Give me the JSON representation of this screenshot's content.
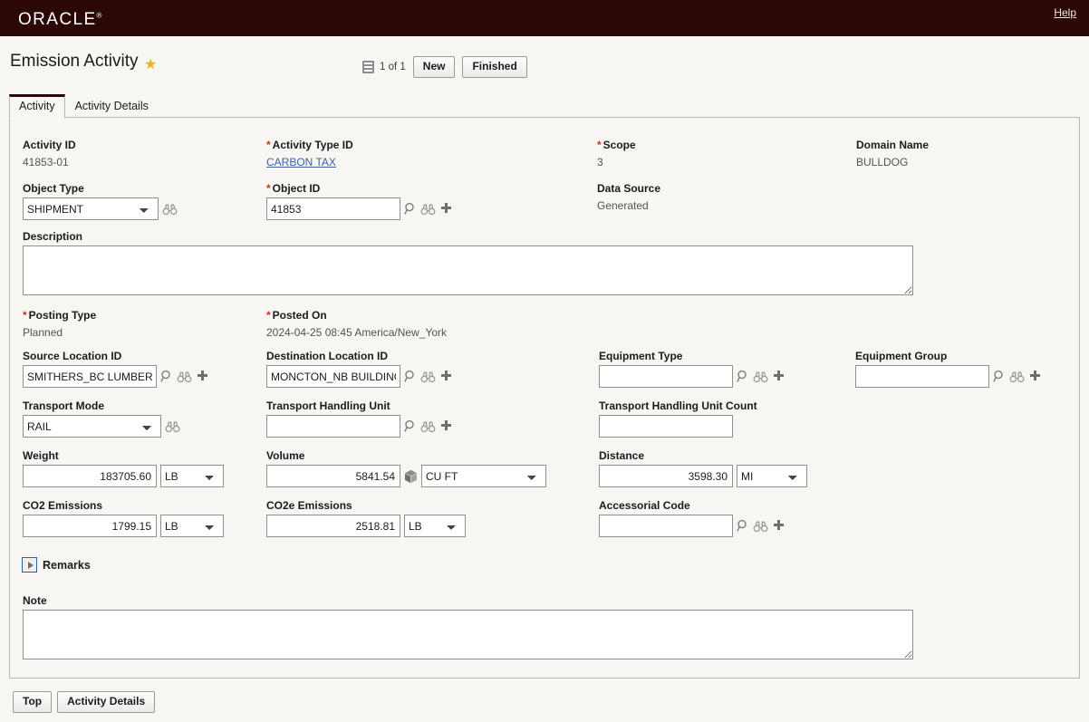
{
  "brand": {
    "name": "ORACLE",
    "trademark": "®",
    "help_label": "Help",
    "bar_color": "#2b0706"
  },
  "header": {
    "title": "Emission Activity",
    "favorite_icon": "star-icon",
    "record_count": "1 of 1",
    "list_icon": "list-view-icon",
    "new_label": "New",
    "finished_label": "Finished"
  },
  "tabs": [
    {
      "label": "Activity",
      "active": true
    },
    {
      "label": "Activity Details",
      "active": false
    }
  ],
  "form": {
    "activity_id": {
      "label": "Activity ID",
      "value": "41853-01"
    },
    "activity_type_id": {
      "label": "Activity Type ID",
      "required": "*",
      "value": "CARBON TAX"
    },
    "scope": {
      "label": "Scope",
      "required": "*",
      "value": "3"
    },
    "domain_name": {
      "label": "Domain Name",
      "value": "BULLDOG"
    },
    "object_type": {
      "label": "Object Type",
      "value": "SHIPMENT",
      "options": [
        "SHIPMENT"
      ]
    },
    "object_id": {
      "label": "Object ID",
      "required": "*",
      "value": "41853"
    },
    "data_source": {
      "label": "Data Source",
      "value": "Generated"
    },
    "description": {
      "label": "Description",
      "value": ""
    },
    "posting_type": {
      "label": "Posting Type",
      "required": "*",
      "value": "Planned"
    },
    "posted_on": {
      "label": "Posted On",
      "required": "*",
      "value": "2024-04-25 08:45 America/New_York"
    },
    "source_location_id": {
      "label": "Source Location ID",
      "value": "SMITHERS_BC LUMBER MILL"
    },
    "destination_location_id": {
      "label": "Destination Location ID",
      "value": "MONCTON_NB BUILDING"
    },
    "equipment_type": {
      "label": "Equipment Type",
      "value": ""
    },
    "equipment_group": {
      "label": "Equipment Group",
      "value": ""
    },
    "transport_mode": {
      "label": "Transport Mode",
      "value": "RAIL",
      "options": [
        "RAIL"
      ]
    },
    "transport_handling_unit": {
      "label": "Transport Handling Unit",
      "value": ""
    },
    "transport_handling_unit_count": {
      "label": "Transport Handling Unit Count",
      "value": ""
    },
    "weight": {
      "label": "Weight",
      "value": "183705.60",
      "uom": "LB",
      "uom_options": [
        "LB"
      ]
    },
    "volume": {
      "label": "Volume",
      "value": "5841.54",
      "uom": "CU FT",
      "uom_options": [
        "CU FT"
      ]
    },
    "distance": {
      "label": "Distance",
      "value": "3598.30",
      "uom": "MI",
      "uom_options": [
        "MI"
      ]
    },
    "co2_emissions": {
      "label": "CO2 Emissions",
      "value": "1799.15",
      "uom": "LB",
      "uom_options": [
        "LB"
      ]
    },
    "co2e_emissions": {
      "label": "CO2e Emissions",
      "value": "2518.81",
      "uom": "LB",
      "uom_options": [
        "LB"
      ]
    },
    "accessorial_code": {
      "label": "Accessorial Code",
      "value": ""
    },
    "remarks": {
      "label": "Remarks",
      "expanded": false
    },
    "note": {
      "label": "Note",
      "value": ""
    }
  },
  "footer": {
    "top_label": "Top",
    "activity_details_label": "Activity Details"
  },
  "icons": {
    "search": "search-icon",
    "binoculars": "binoculars-icon",
    "plus": "plus-icon",
    "cube": "cube-icon"
  }
}
